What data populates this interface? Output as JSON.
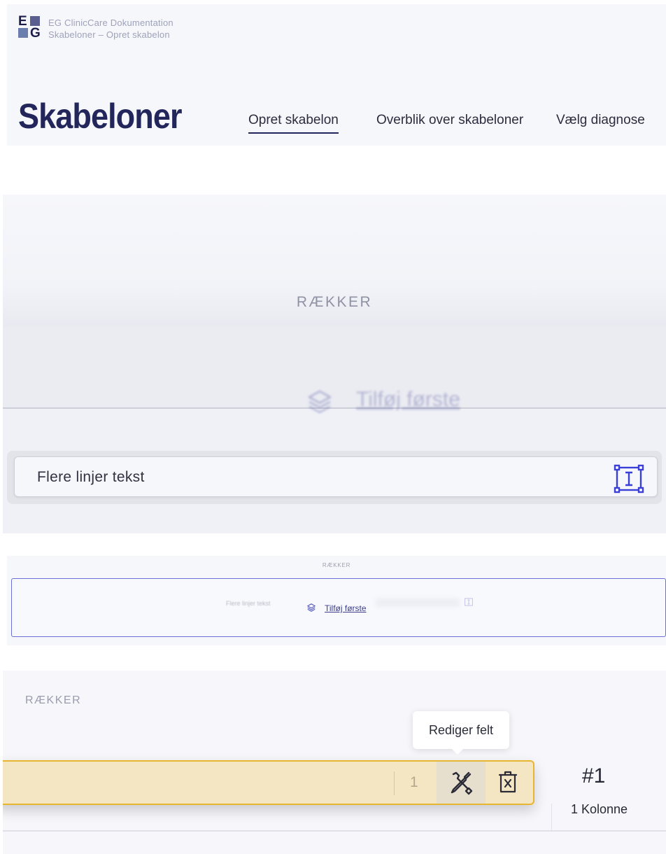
{
  "header": {
    "logo_letters": [
      "E",
      "G"
    ],
    "app_name": "EG ClinicCare Dokumentation",
    "breadcrumb": "Skabeloner – Opret skabelon",
    "page_title": "Skabeloner",
    "nav": [
      {
        "label": "Opret skabelon",
        "active": true
      },
      {
        "label": "Overblik over skabeloner",
        "active": false
      },
      {
        "label": "Vælg diagnose",
        "active": false
      }
    ]
  },
  "zoom_panel": {
    "rows_label": "RÆKKER",
    "add_first_label": "Tilføj første",
    "dragged_field_label": "Flere linjer tekst",
    "dragged_field_icon": "multiline-text-icon"
  },
  "overview_panel": {
    "rows_label": "RÆKKER",
    "field_label": "Flere linjer tekst",
    "add_first_label": "Tilføj første"
  },
  "row_panel": {
    "rows_label": "RÆKKER",
    "tooltip": "Rediger felt",
    "column_count_value": "1",
    "row_number": "#1",
    "row_columns": "1 Kolonne"
  },
  "colors": {
    "accent": "#6d6fd6",
    "title": "#23265a",
    "selected_row_bg": "#f5e6c3",
    "selected_row_border": "#e8b530"
  }
}
